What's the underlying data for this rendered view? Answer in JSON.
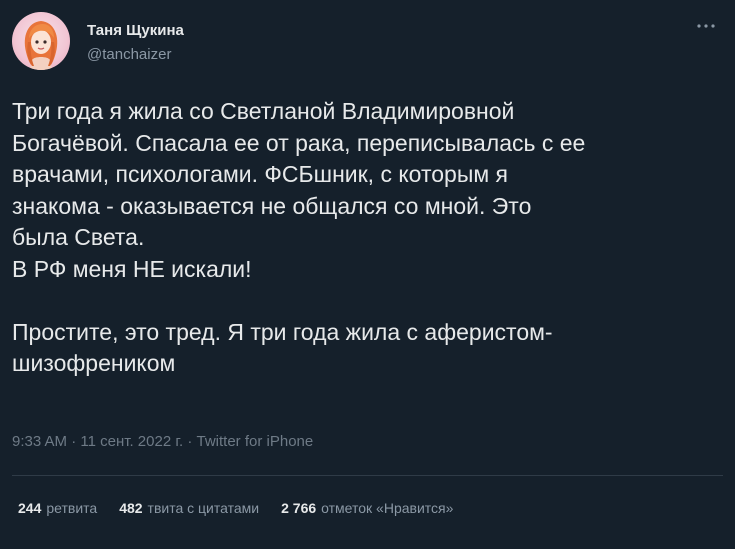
{
  "author": {
    "display_name": "Таня Щукина",
    "handle": "@tanchaizer"
  },
  "menu_icon": "more-dots-icon",
  "tweet": {
    "lines": [
      "Три года я жила со Светланой Владимировной",
      "Богачёвой. Спасала ее от рака, переписывалась с ее",
      "врачами, психологами. ФСБшник, с которым я",
      "знакома - оказывается не общался со мной. Это",
      "была Света.",
      "В РФ меня НЕ искали!",
      "",
      "Простите, это тред. Я три года жила с аферистом-",
      "шизофреником"
    ]
  },
  "meta": {
    "time": "9:33 AM",
    "sep1": " · ",
    "date": "11 сент. 2022 г.",
    "sep2": " · ",
    "source": "Twitter for iPhone"
  },
  "stats": {
    "retweets": {
      "count": "244",
      "label": "ретвита"
    },
    "quotes": {
      "count": "482",
      "label": "твита с цитатами"
    },
    "likes": {
      "count": "2 766",
      "label": "отметок «Нравится»"
    }
  },
  "colors": {
    "background": "#15202b",
    "text": "#e7e9ea",
    "secondary": "#8b98a5"
  }
}
